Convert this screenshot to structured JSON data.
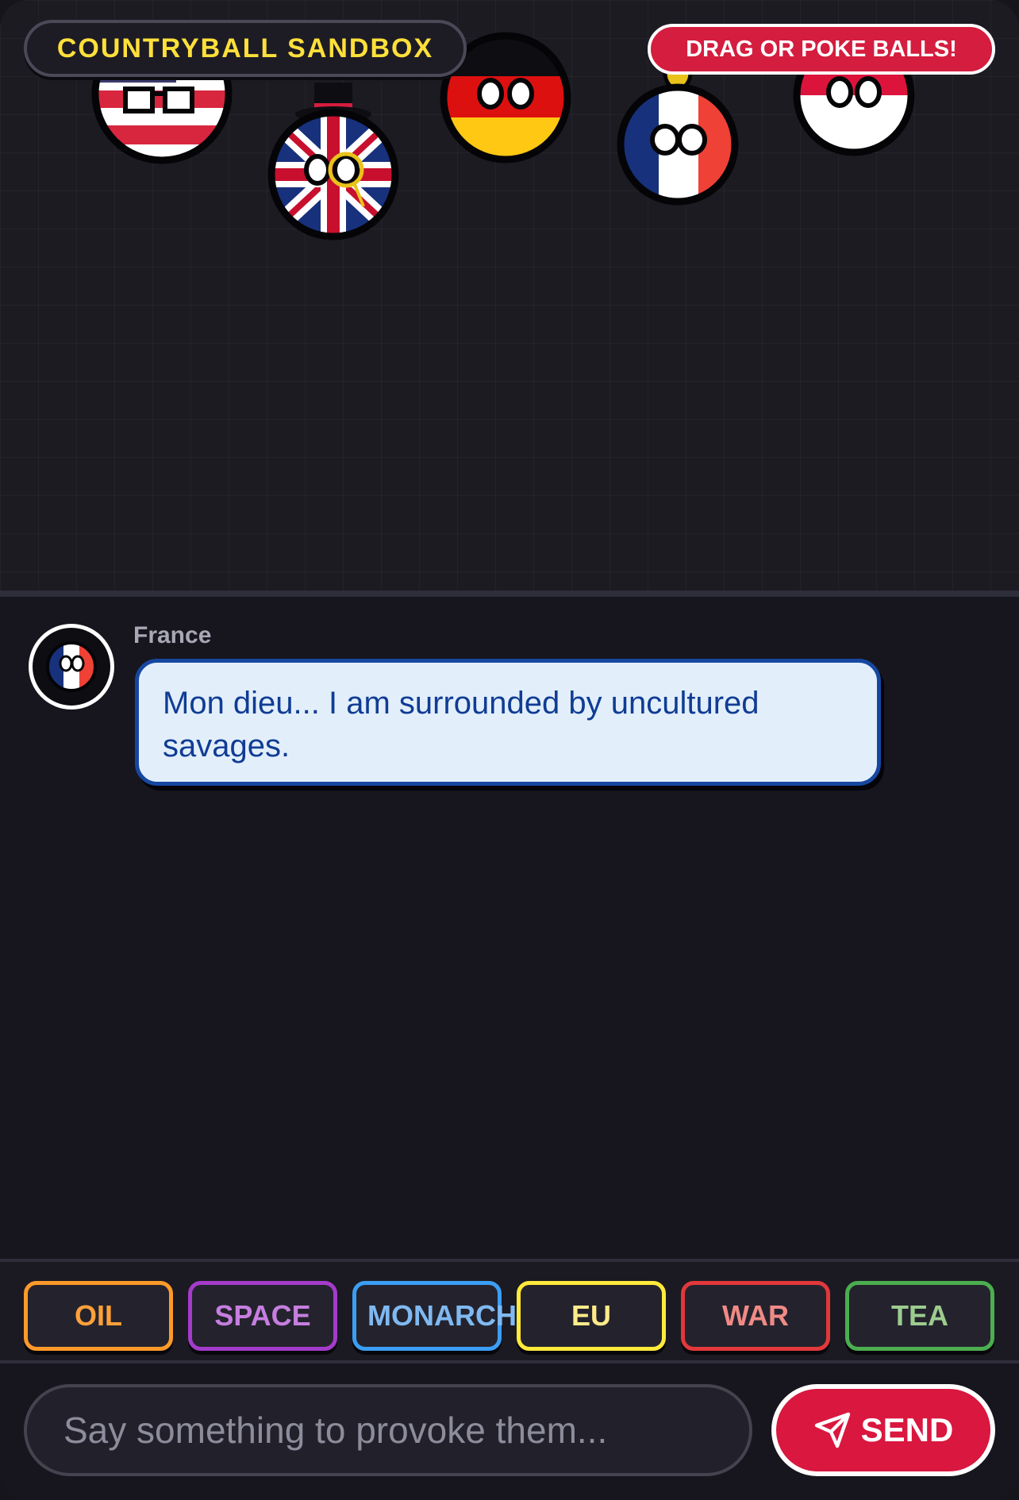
{
  "header": {
    "title": "COUNTRYBALL SANDBOX",
    "hint": "DRAG OR POKE BALLS!"
  },
  "balls": [
    {
      "name": "usa-ball",
      "colors": [
        "#b22234",
        "#ffffff",
        "#3c3b6e"
      ]
    },
    {
      "name": "uk-ball",
      "colors": [
        "#012169",
        "#ffffff",
        "#c8102e"
      ]
    },
    {
      "name": "germany-ball",
      "colors": [
        "#000000",
        "#dd0000",
        "#ffce00"
      ]
    },
    {
      "name": "france-ball",
      "colors": [
        "#0055a4",
        "#ffffff",
        "#ef4135"
      ]
    },
    {
      "name": "poland-ball",
      "colors": [
        "#ffffff",
        "#dc143c"
      ]
    }
  ],
  "chat": {
    "messages": [
      {
        "sender": "France",
        "text": "Mon dieu... I am surrounded by uncultured savages."
      }
    ]
  },
  "topics": [
    {
      "label": "OIL",
      "color": "#ff9a2a"
    },
    {
      "label": "SPACE",
      "color": "#a53bcb"
    },
    {
      "label": "MONARCH",
      "color": "#3b9ef5"
    },
    {
      "label": "EU",
      "color": "#ffea3b"
    },
    {
      "label": "WAR",
      "color": "#e2383b"
    },
    {
      "label": "TEA",
      "color": "#4cae4f"
    }
  ],
  "composer": {
    "placeholder": "Say something to provoke them...",
    "send_label": "SEND"
  }
}
